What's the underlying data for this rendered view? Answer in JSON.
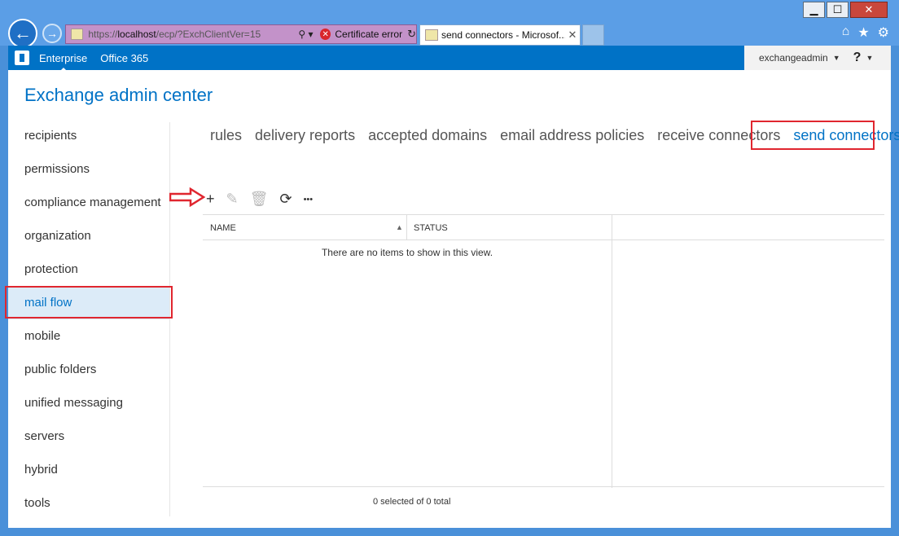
{
  "window": {
    "controls": {
      "minimize": "▁",
      "maximize": "☐",
      "close": "✕"
    }
  },
  "browser": {
    "back_icon": "back-arrow-icon",
    "forward_icon": "forward-arrow-icon",
    "address": {
      "url_prefix": "https://",
      "url_host": "localhost",
      "url_path": "/ecp/?ExchClientVer=15",
      "search_glyph": "⚲ ▾",
      "certificate_error": "Certificate error"
    },
    "tab": {
      "title": "send connectors - Microsof...",
      "close": "✕"
    },
    "toolbar_icons": [
      "home-icon",
      "favorites-star-icon",
      "tools-gear-icon"
    ]
  },
  "eac_topbar": {
    "links": [
      {
        "label": "Enterprise",
        "active": true
      },
      {
        "label": "Office 365",
        "active": false
      }
    ],
    "user": "exchangeadmin",
    "help": "?"
  },
  "page": {
    "title": "Exchange admin center"
  },
  "leftnav": {
    "items": [
      {
        "label": "recipients"
      },
      {
        "label": "permissions"
      },
      {
        "label": "compliance management"
      },
      {
        "label": "organization"
      },
      {
        "label": "protection"
      },
      {
        "label": "mail flow",
        "selected": true
      },
      {
        "label": "mobile"
      },
      {
        "label": "public folders"
      },
      {
        "label": "unified messaging"
      },
      {
        "label": "servers"
      },
      {
        "label": "hybrid"
      },
      {
        "label": "tools"
      }
    ]
  },
  "subnav": {
    "items": [
      {
        "label": "rules"
      },
      {
        "label": "delivery reports"
      },
      {
        "label": "accepted domains"
      },
      {
        "label": "email address policies"
      },
      {
        "label": "receive connectors"
      },
      {
        "label": "send connectors",
        "active": true
      }
    ]
  },
  "toolbar": {
    "add": "+",
    "edit": "✎",
    "delete": "🗑",
    "refresh": "⟳",
    "more": "•••"
  },
  "grid": {
    "columns": [
      "NAME",
      "STATUS"
    ],
    "sort_indicator": "▲",
    "empty_message": "There are no items to show in this view.",
    "footer": "0 selected of 0 total"
  },
  "colors": {
    "accent": "#0072c6",
    "annotation": "#e0262f",
    "selected_bg": "#dcebf8"
  }
}
